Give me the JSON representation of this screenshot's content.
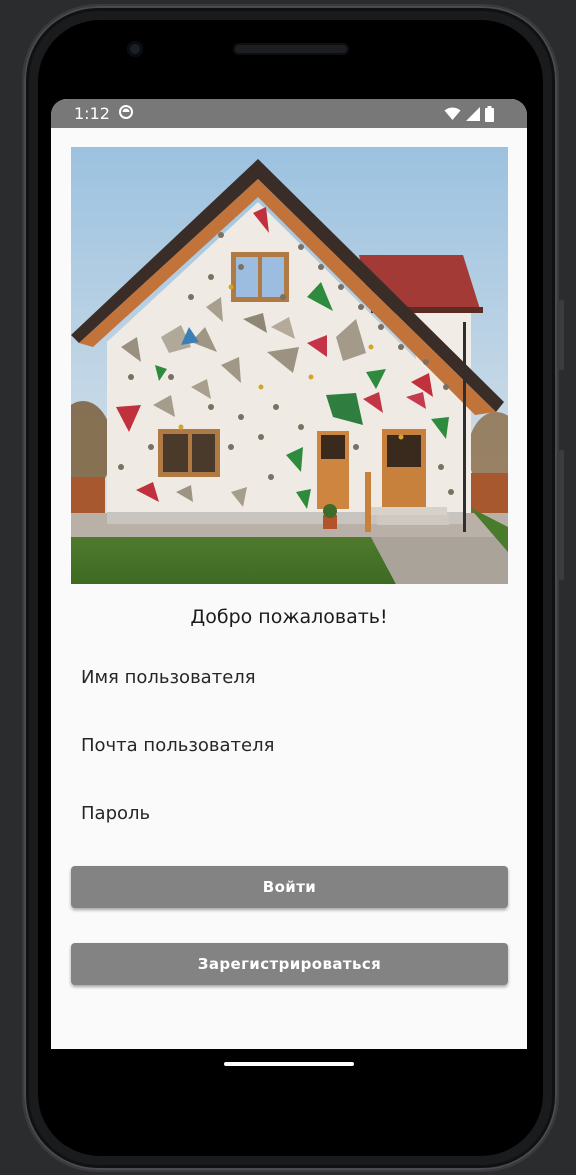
{
  "status_bar": {
    "time": "1:12",
    "icons": [
      "app-notification-icon",
      "wifi-icon",
      "cellular-signal-icon",
      "battery-icon"
    ]
  },
  "hero": {
    "image_icon": "climbing-wall-house-image"
  },
  "form": {
    "title": "Добро пожаловать!",
    "username_placeholder": "Имя пользователя",
    "email_placeholder": "Почта пользователя",
    "password_placeholder": "Пароль",
    "login_label": "Войти",
    "register_label": "Зарегистрироваться"
  },
  "colors": {
    "status_bar": "#787878",
    "button": "#838383",
    "screen_bg": "#fafafa",
    "device_bg": "#2b2c2e"
  }
}
